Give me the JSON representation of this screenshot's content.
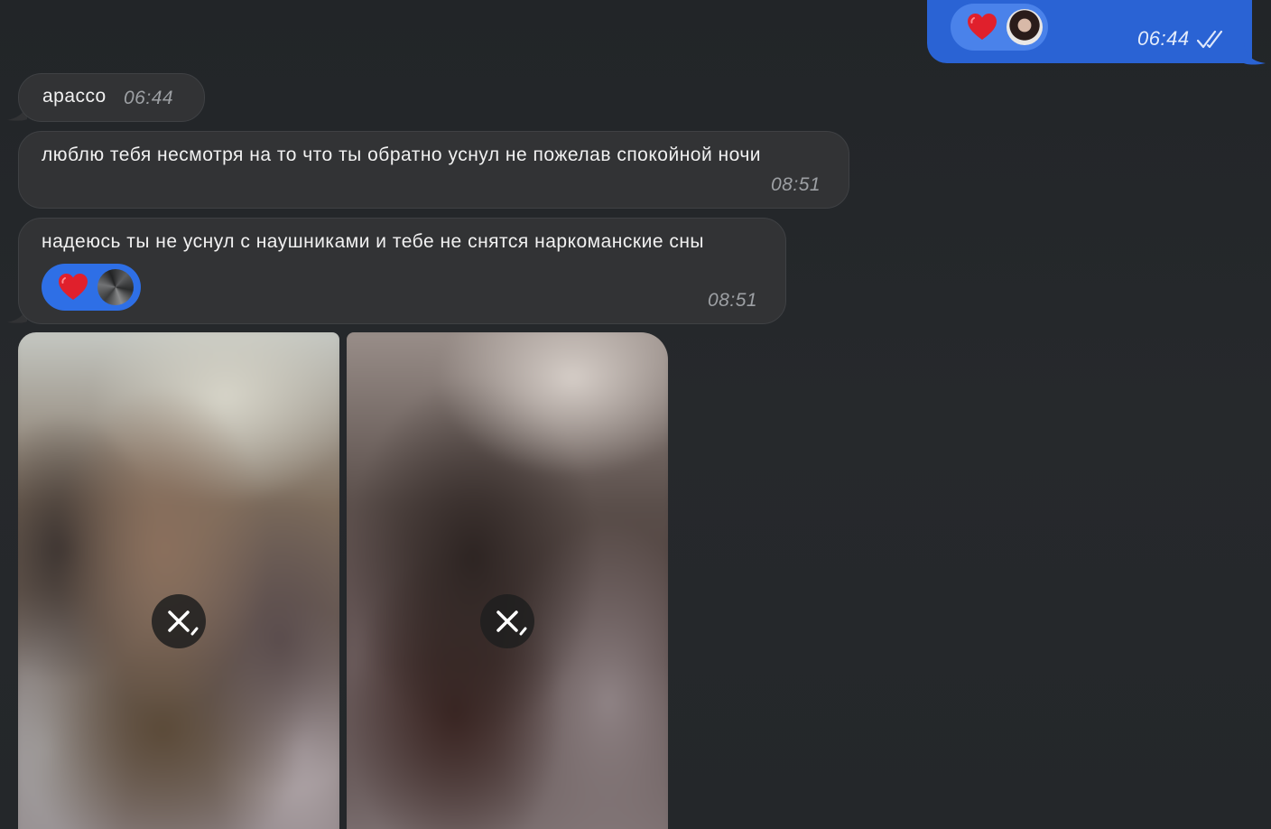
{
  "colors": {
    "background": "#25282b",
    "outgoing_bubble": "#2a63d4",
    "incoming_bubble": "#323335",
    "reaction_pill": "#2e6fe6",
    "heart": "#e0202c",
    "time_text_incoming": "#9da0a4"
  },
  "outgoing": {
    "time": "06:44",
    "read_status_icon": "double-check-icon",
    "reaction": {
      "emoji_icon": "heart-icon",
      "reactor_avatar": "avatar-icon"
    }
  },
  "messages": [
    {
      "text": "apacco",
      "time": "06:44"
    },
    {
      "text": "люблю тебя несмотря на то что ты обратно уснул не пожелав спокойной ночи",
      "time": "08:51"
    },
    {
      "text": "надеюсь ты не уснул с наушниками и тебе не снятся наркоманские сны",
      "time": "08:51",
      "reaction": {
        "emoji_icon": "heart-icon",
        "reactor_avatar": "avatar-icon"
      }
    }
  ],
  "media": [
    {
      "state": "blurred",
      "action_icon": "close-icon"
    },
    {
      "state": "blurred",
      "action_icon": "close-icon"
    }
  ]
}
